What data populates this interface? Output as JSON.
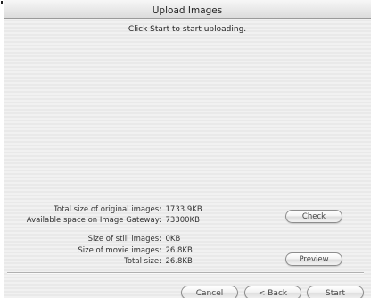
{
  "window": {
    "title": "Upload Images"
  },
  "instruction": "Click Start to start uploading.",
  "stats": {
    "total_original_label": "Total size of original images:",
    "total_original_value": "1733.9KB",
    "available_space_label": "Available space on Image Gateway:",
    "available_space_value": "73300KB",
    "still_images_label": "Size of still images:",
    "still_images_value": "0KB",
    "movie_images_label": "Size of movie images:",
    "movie_images_value": "26.8KB",
    "total_size_label": "Total size:",
    "total_size_value": "26.8KB"
  },
  "buttons": {
    "check": "Check",
    "preview": "Preview",
    "cancel": "Cancel",
    "back": "< Back",
    "start": "Start"
  }
}
